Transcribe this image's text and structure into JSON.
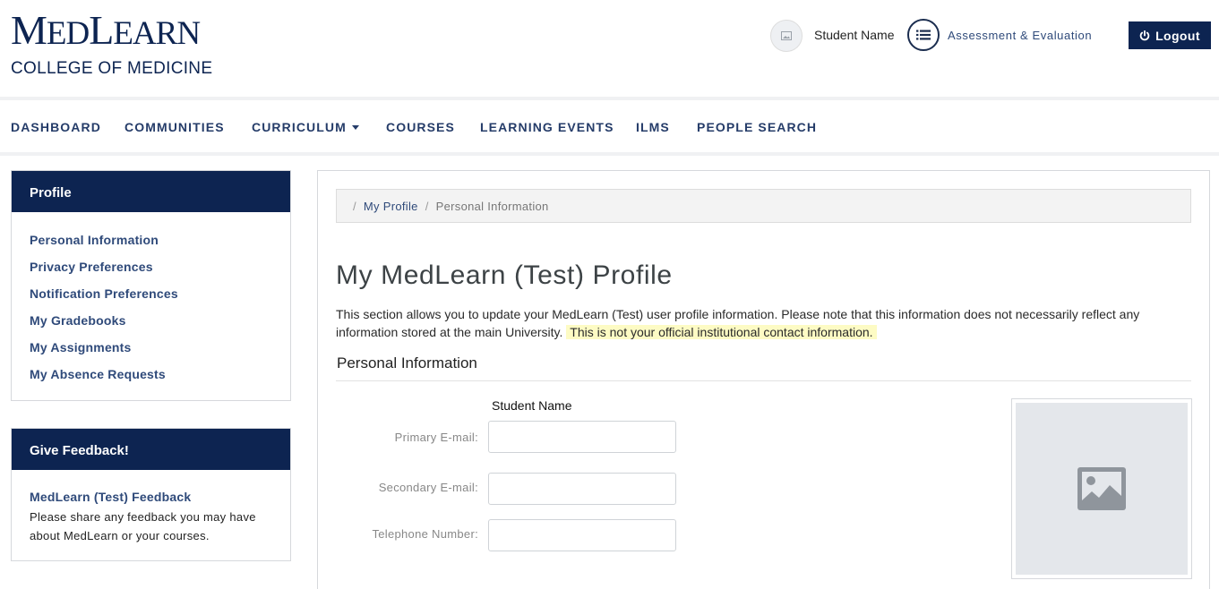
{
  "header": {
    "logo_main": "MEDLEARN",
    "logo_sub": "COLLEGE OF MEDICINE",
    "user_name": "Student Name",
    "assessment_link": "Assessment & Evaluation",
    "logout_label": "Logout",
    "brand_color": "#0d2451"
  },
  "nav": {
    "items": [
      {
        "label": "DASHBOARD"
      },
      {
        "label": "COMMUNITIES"
      },
      {
        "label": "CURRICULUM"
      },
      {
        "label": "COURSES"
      },
      {
        "label": "LEARNING EVENTS"
      },
      {
        "label": "ILMS"
      },
      {
        "label": "PEOPLE SEARCH"
      }
    ]
  },
  "sidebar": {
    "profile_title": "Profile",
    "profile_links": [
      {
        "label": "Personal Information"
      },
      {
        "label": "Privacy Preferences"
      },
      {
        "label": "Notification Preferences"
      },
      {
        "label": "My Gradebooks"
      },
      {
        "label": "My Assignments"
      },
      {
        "label": "My Absence Requests"
      }
    ],
    "feedback_title": "Give Feedback!",
    "feedback_link": "MedLearn (Test) Feedback",
    "feedback_text": "Please share any feedback you may have about MedLearn or your courses."
  },
  "main": {
    "breadcrumb": {
      "sep": "/",
      "link": "My Profile",
      "current": "Personal Information"
    },
    "title": "My MedLearn (Test) Profile",
    "intro": "This section allows you to update your MedLearn (Test) user profile information. Please note that this information does not necessarily reflect any information stored at the main University.",
    "intro_highlight": "This is not your official institutional contact information.",
    "section_title": "Personal Information",
    "student_name": "Student Name",
    "fields": {
      "primary_email_label": "Primary E-mail:",
      "primary_email_value": "",
      "secondary_email_label": "Secondary E-mail:",
      "secondary_email_value": "",
      "telephone_label": "Telephone Number:",
      "telephone_value": ""
    },
    "photo_icon": "image-placeholder-icon"
  }
}
